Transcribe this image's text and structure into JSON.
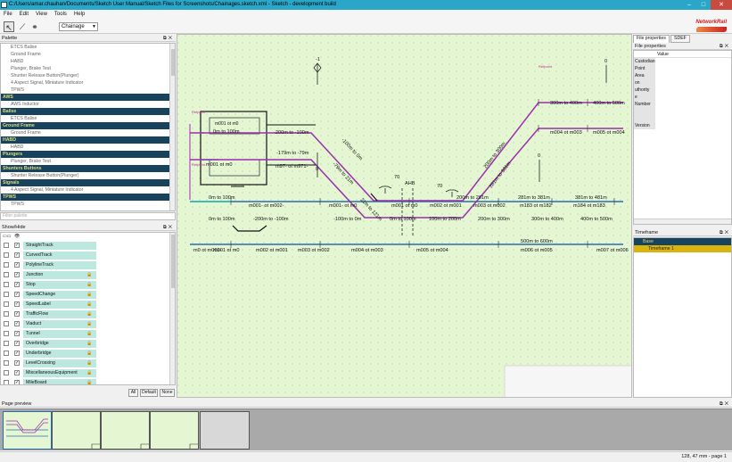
{
  "window": {
    "title": "C:/Users/amar.chauhan/Documents/Sketch User Manual/Sketch Files for Screenshots/Chainages.sketch.xml - Sketch - development build",
    "min": "–",
    "max": "□",
    "close": "✕"
  },
  "menu": [
    "File",
    "Edit",
    "View",
    "Tools",
    "Help"
  ],
  "toolbar": {
    "mode_select": "Chainage",
    "logo_text": "NetworkRail"
  },
  "panels": {
    "palette_title": "Palette",
    "filter_placeholder": "Filter palette",
    "show_hide_title": "Show/Hide",
    "page_preview_title": "Page preview",
    "timeframe_title": "Timeframe",
    "float": "⧉",
    "close": "✕"
  },
  "palette": [
    {
      "text": "ETCS Balise",
      "cat": false
    },
    {
      "text": "Ground Frame",
      "cat": false
    },
    {
      "text": "HABD",
      "cat": false
    },
    {
      "text": "Plunger, Brake Test",
      "cat": false
    },
    {
      "text": "Shunter Release Button(Plunger)",
      "cat": false
    },
    {
      "text": "4 Aspect Signal, Miniature Indicator",
      "cat": false
    },
    {
      "text": "TPWS",
      "cat": false
    },
    {
      "text": "AWS",
      "cat": true
    },
    {
      "text": "AWS Inductor",
      "cat": false
    },
    {
      "text": "Balise",
      "cat": true
    },
    {
      "text": "ETCS Balise",
      "cat": false
    },
    {
      "text": "Ground Frame",
      "cat": true
    },
    {
      "text": "Ground Frame",
      "cat": false
    },
    {
      "text": "HABD",
      "cat": true
    },
    {
      "text": "HABD",
      "cat": false
    },
    {
      "text": "Plungers",
      "cat": true
    },
    {
      "text": "Plunger, Brake Test",
      "cat": false
    },
    {
      "text": "Shunters Buttons",
      "cat": true
    },
    {
      "text": "Shunter Release Button(Plunger)",
      "cat": false
    },
    {
      "text": "Signals",
      "cat": true
    },
    {
      "text": "4 Aspect Signal, Miniature Indicator",
      "cat": false
    },
    {
      "text": "TPWS",
      "cat": true
    },
    {
      "text": "TPWS",
      "cat": false
    }
  ],
  "show_hide": {
    "header_icons": [
      "▭▭",
      "👁"
    ],
    "items": [
      {
        "label": "StraightTrack",
        "lock": false
      },
      {
        "label": "CurvedTrack",
        "lock": false
      },
      {
        "label": "PolylineTrack",
        "lock": false
      },
      {
        "label": "Junction",
        "lock": true
      },
      {
        "label": "Stop",
        "lock": true
      },
      {
        "label": "SpeedChange",
        "lock": true
      },
      {
        "label": "SpeedLabel",
        "lock": true
      },
      {
        "label": "TrafficFlow",
        "lock": true
      },
      {
        "label": "Viaduct",
        "lock": true
      },
      {
        "label": "Tunnel",
        "lock": true
      },
      {
        "label": "Overbridge",
        "lock": true
      },
      {
        "label": "Underbridge",
        "lock": true
      },
      {
        "label": "LevelCrossing",
        "lock": true
      },
      {
        "label": "MiscellaneousEquipment",
        "lock": true
      },
      {
        "label": "MileBoard",
        "lock": true
      }
    ],
    "check": "✓",
    "lock_icon": "🔒",
    "buttons": [
      "All",
      "Default",
      "None"
    ]
  },
  "properties": {
    "tabs": [
      "File properties",
      "SDEF"
    ],
    "header": "File properties",
    "value_col": "Value",
    "rows": [
      "Custodian",
      "Point",
      "Area",
      "on",
      "uthority",
      "e",
      "Number",
      "",
      "",
      "Version"
    ]
  },
  "timeframe": {
    "base": "Base",
    "item": "Timeframe 1"
  },
  "canvas": {
    "labels": {
      "mark_neg1": "-1",
      "mark_0a": "0",
      "mark_0b": "0",
      "mark_0c": "0",
      "mark_70a": "70",
      "mark_70b": "70",
      "ahb": "AHB",
      "ref_a": "Refpoint",
      "ref_b": "Refpoint",
      "ref_c": "Refpoint",
      "c_0_100_a": "0m to 100m",
      "c_0_100_b": "0m to 100m",
      "c_0_100_c": "0m to 100m",
      "c_0_100_d": "0m to 100m",
      "c_0_100_e": "0m to 100m",
      "c_n200_n100": "-200m to -100m",
      "c_n200_n100_b": "-200m to -100m",
      "c_n100_0": "-100m to 0m",
      "c_n179_n79": "-179m to -79m",
      "c_100_200": "100m to 200m",
      "c_100_200_b": "100m to 200m",
      "c_200_300": "200m to 300m",
      "c_300_400": "300m to 400m",
      "c_300_400_b": "300m to 400m",
      "c_400_500": "400m to 500m",
      "c_400_500_b": "400m to 500m",
      "c_400_500_c": "400m to 500m",
      "c_500_600": "500m to 600m",
      "c_200_281": "200m to 281m",
      "c_281_381": "281m to 381m",
      "c_381_481": "381m to 481m",
      "c_diag_a": "-100m to 0m",
      "c_diag_b": "-79m to 21m",
      "c_diag_c": "21m to 121m",
      "c_diag_d": "200m to 300m",
      "c_diag_e": "281m to 381m",
      "m_n100_0": "m001- ot m0",
      "m_n179_n79": "m97- ot m971-",
      "m_0_100": "m001 ot m0",
      "m_0_100b": "m001 ot m0",
      "m_100_200": "m002 ot m001",
      "m_200_300": "m003 ot m002",
      "m_300_400": "m004 ot m003",
      "m_400_500": "m005 ot m004",
      "m_500_600": "m006 ot m005",
      "m_600_700": "m007 ot m006",
      "m_n100_0b": "m0 ot m001-",
      "m_n200_n100": "m001- ot m002-",
      "m_100_200b": "m002 ot m001",
      "m_300_400b": "m004 ot m003",
      "m_400_500b": "m005 ot m004",
      "m_200_300b": "m003 ot m002",
      "m_281_381": "m183 ot m182",
      "m_381_481": "m184 ot m183",
      "m_0_100c": "m001 ot m0"
    }
  },
  "status": {
    "coords": "128, 47 mm - page 1"
  }
}
